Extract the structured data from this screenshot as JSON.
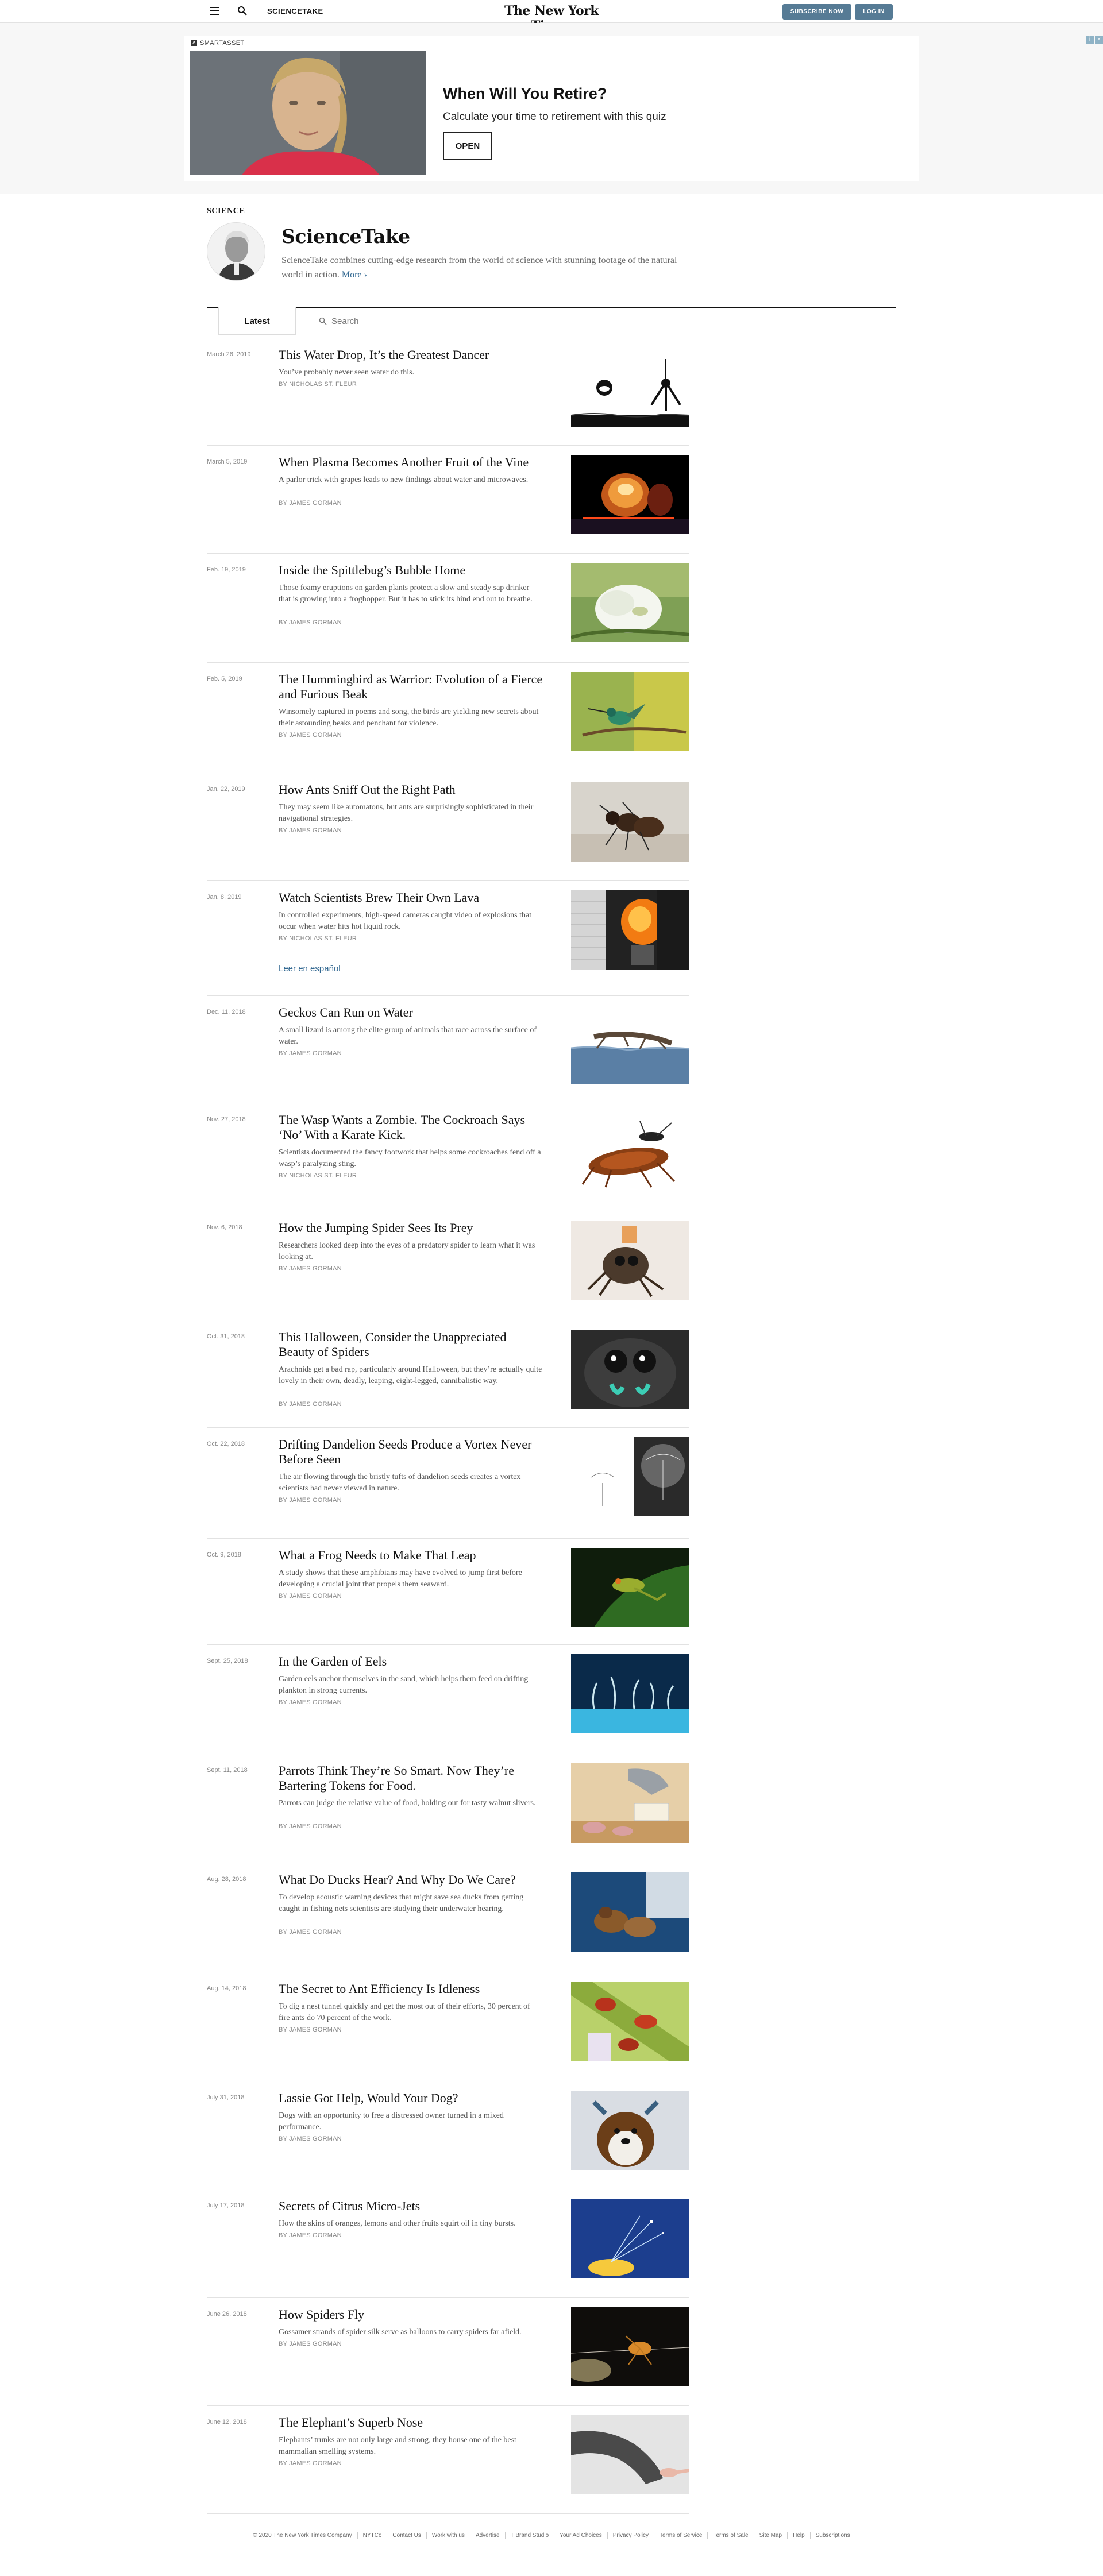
{
  "topbar": {
    "section": "SCIENCETAKE",
    "logo": "The New York Times",
    "subscribe": "SUBSCRIBE NOW",
    "login": "LOG IN"
  },
  "ad": {
    "label": "SMARTASSET",
    "title": "When Will You Retire?",
    "subtitle": "Calculate your time to retirement with this quiz",
    "button": "OPEN"
  },
  "header": {
    "kicker": "SCIENCE",
    "title": "ScienceTake",
    "description": "ScienceTake combines cutting-edge research from the world of science with stunning footage of the natural world in action.",
    "more": "More ›"
  },
  "tabs": {
    "latest": "Latest",
    "search_placeholder": "Search"
  },
  "articles": [
    {
      "date": "March 26, 2019",
      "headline": "This Water Drop, It’s the Greatest Dancer",
      "summary": "You’ve probably never seen water do this.",
      "byline": "By NICHOLAS ST. FLEUR",
      "image": "water-drop"
    },
    {
      "date": "March 5, 2019",
      "headline": "When Plasma Becomes Another Fruit of the Vine",
      "summary": "A parlor trick with grapes leads to new findings about water and microwaves.",
      "byline": "By JAMES GORMAN",
      "image": "plasma"
    },
    {
      "date": "Feb. 19, 2019",
      "headline": "Inside the Spittlebug’s Bubble Home",
      "summary": "Those foamy eruptions on garden plants protect a slow and steady sap drinker that is growing into a froghopper. But it has to stick its hind end out to breathe.",
      "byline": "By JAMES GORMAN",
      "image": "spittlebug"
    },
    {
      "date": "Feb. 5, 2019",
      "headline": "The Hummingbird as Warrior: Evolution of a Fierce and Furious Beak",
      "summary": "Winsomely captured in poems and song, the birds are yielding new secrets about their astounding beaks and penchant for violence.",
      "byline": "By JAMES GORMAN",
      "image": "hummingbird"
    },
    {
      "date": "Jan. 22, 2019",
      "headline": "How Ants Sniff Out the Right Path",
      "summary": "They may seem like automatons, but ants are surprisingly sophisticated in their navigational strategies.",
      "byline": "By JAMES GORMAN",
      "image": "ant"
    },
    {
      "date": "Jan. 8, 2019",
      "headline": "Watch Scientists Brew Their Own Lava",
      "summary": "In controlled experiments, high-speed cameras caught video of explosions that occur when water hits hot liquid rock.",
      "byline": "By NICHOLAS ST. FLEUR",
      "extra": "Leer en español",
      "image": "lava"
    },
    {
      "date": "Dec. 11, 2018",
      "headline": "Geckos Can Run on Water",
      "summary": "A small lizard is among the elite group of animals that race across the surface of water.",
      "byline": "By JAMES GORMAN",
      "image": "gecko"
    },
    {
      "date": "Nov. 27, 2018",
      "headline": "The Wasp Wants a Zombie. The Cockroach Says ‘No’ With a Karate Kick.",
      "summary": "Scientists documented the fancy footwork that helps some cockroaches fend off a wasp’s paralyzing sting.",
      "byline": "By NICHOLAS ST. FLEUR",
      "image": "cockroach"
    },
    {
      "date": "Nov. 6, 2018",
      "headline": "How the Jumping Spider Sees Its Prey",
      "summary": "Researchers looked deep into the eyes of a predatory spider to learn what it was looking at.",
      "byline": "By JAMES GORMAN",
      "image": "jumping-spider"
    },
    {
      "date": "Oct. 31, 2018",
      "headline": "This Halloween, Consider the Unappreciated Beauty of Spiders",
      "summary": "Arachnids get a bad rap, particularly around Halloween, but they’re actually quite lovely in their own, deadly, leaping, eight-legged, cannibalistic way.",
      "byline": "By JAMES GORMAN",
      "image": "spider-eyes"
    },
    {
      "date": "Oct. 22, 2018",
      "headline": "Drifting Dandelion Seeds Produce a Vortex Never Before Seen",
      "summary": "The air flowing through the bristly tufts of dandelion seeds creates a vortex scientists had never viewed in nature.",
      "byline": "By JAMES GORMAN",
      "image": "dandelion"
    },
    {
      "date": "Oct. 9, 2018",
      "headline": "What a Frog Needs to Make That Leap",
      "summary": "A study shows that these amphibians may have evolved to jump first before developing a crucial joint that propels them seaward.",
      "byline": "By JAMES GORMAN",
      "image": "frog"
    },
    {
      "date": "Sept. 25, 2018",
      "headline": "In the Garden of Eels",
      "summary": "Garden eels anchor themselves in the sand, which helps them feed on drifting plankton in strong currents.",
      "byline": "By JAMES GORMAN",
      "image": "eels"
    },
    {
      "date": "Sept. 11, 2018",
      "headline": "Parrots Think They’re So Smart. Now They’re Bartering Tokens for Food.",
      "summary": "Parrots can judge the relative value of food, holding out for tasty walnut slivers.",
      "byline": "By JAMES GORMAN",
      "image": "parrot"
    },
    {
      "date": "Aug. 28, 2018",
      "headline": "What Do Ducks Hear? And Why Do We Care?",
      "summary": "To develop acoustic warning devices that might save sea ducks from getting caught in fishing nets scientists are studying their underwater hearing.",
      "byline": "By JAMES GORMAN",
      "image": "ducks"
    },
    {
      "date": "Aug. 14, 2018",
      "headline": "The Secret to Ant Efficiency Is Idleness",
      "summary": "To dig a nest tunnel quickly and get the most out of their efforts, 30 percent of fire ants do 70 percent of the work.",
      "byline": "By JAMES GORMAN",
      "image": "fire-ants"
    },
    {
      "date": "July 31, 2018",
      "headline": "Lassie Got Help, Would Your Dog?",
      "summary": "Dogs with an opportunity to free a distressed owner turned in a mixed performance.",
      "byline": "By JAMES GORMAN",
      "image": "dog"
    },
    {
      "date": "July 17, 2018",
      "headline": "Secrets of Citrus Micro-Jets",
      "summary": "How the skins of oranges, lemons and other fruits squirt oil in tiny bursts.",
      "byline": "By JAMES GORMAN",
      "image": "citrus"
    },
    {
      "date": "June 26, 2018",
      "headline": "How Spiders Fly",
      "summary": "Gossamer strands of spider silk serve as balloons to carry spiders far afield.",
      "byline": "By JAMES GORMAN",
      "image": "spider-fly"
    },
    {
      "date": "June 12, 2018",
      "headline": "The Elephant’s Superb Nose",
      "summary": "Elephants’ trunks are not only large and strong, they house one of the best mammalian smelling systems.",
      "byline": "By JAMES GORMAN",
      "image": "elephant"
    }
  ],
  "footer": [
    "© 2020 The New York Times Company",
    "NYTCo",
    "Contact Us",
    "Work with us",
    "Advertise",
    "T Brand Studio",
    "Your Ad Choices",
    "Privacy Policy",
    "Terms of Service",
    "Terms of Sale",
    "Site Map",
    "Help",
    "Subscriptions"
  ]
}
